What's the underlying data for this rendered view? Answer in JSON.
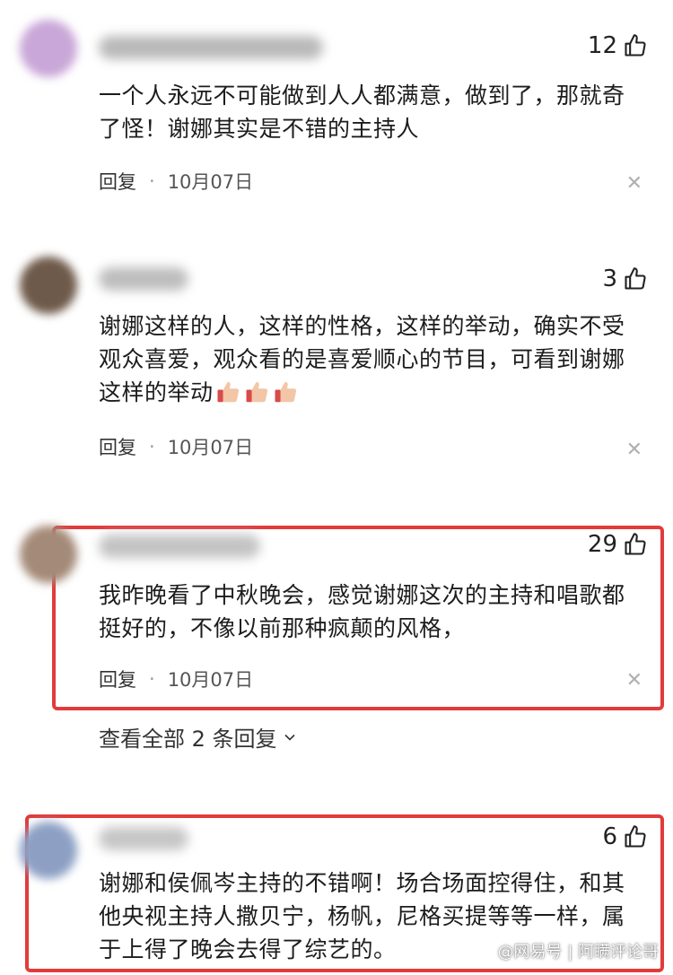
{
  "comments": [
    {
      "likes": "12",
      "text": "一个人永远不可能做到人人都满意，做到了，那就奇了怪！谢娜其实是不错的主持人",
      "reply_label": "回复",
      "date": "10月07日",
      "avatar_color": "#c9a7d8",
      "username_color": "#b9b9b9"
    },
    {
      "likes": "3",
      "text": "谢娜这样的人，这样的性格，这样的举动，确实不受观众喜爱，观众看的是喜爱顺心的节目，可看到谢娜这样的举动",
      "emoji": [
        "thumbs-up",
        "thumbs-up",
        "thumbs-up"
      ],
      "reply_label": "回复",
      "date": "10月07日",
      "avatar_color": "#6e5a4a",
      "username_color": "#bdbdbd"
    },
    {
      "likes": "29",
      "text": "我昨晚看了中秋晚会，感觉谢娜这次的主持和唱歌都挺好的，不像以前那种疯颠的风格，",
      "reply_label": "回复",
      "date": "10月07日",
      "view_replies": "查看全部 2 条回复",
      "avatar_color": "#a48a78",
      "username_color": "#c3c3c3"
    },
    {
      "likes": "6",
      "text": "谢娜和侯佩岑主持的不错啊！场合场面控得住，和其他央视主持人撒贝宁，杨帆，尼格买提等等一样，属于上得了晚会去得了综艺的。",
      "avatar_color": "#8da0c4",
      "username_color": "#c6c6c6"
    }
  ],
  "icons": {
    "like": "thumbs-up-outline-icon",
    "close": "close-icon",
    "expand": "chevron-down-icon"
  },
  "highlight_color": "#e23b3b",
  "watermark": "@网易号 | 阿瞒评论哥"
}
